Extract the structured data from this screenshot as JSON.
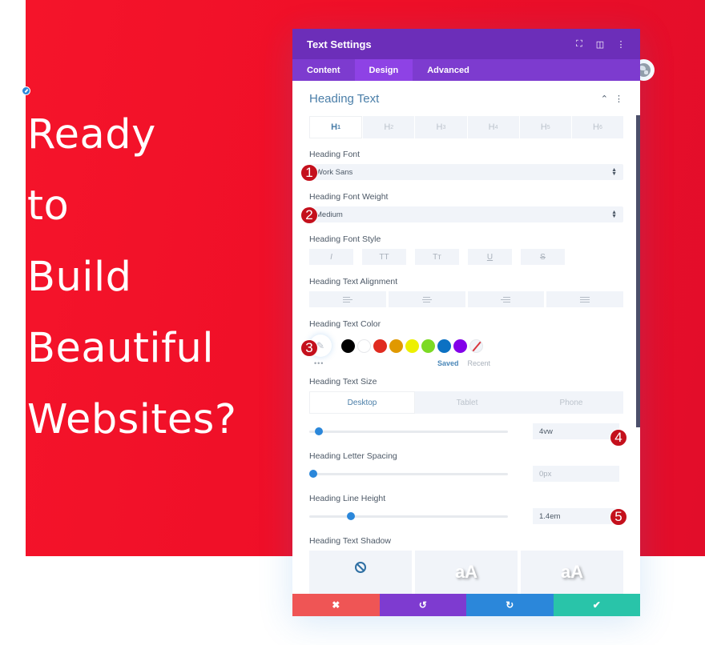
{
  "hero": {
    "heading_lines": [
      "Ready",
      "to",
      "Build",
      "Beautiful",
      "Websites?"
    ],
    "background_color": "#f0102a"
  },
  "modal": {
    "title": "Text Settings",
    "header_icons": [
      "expand-icon",
      "split-view-icon",
      "more-vertical-icon"
    ],
    "tabs": [
      {
        "label": "Content",
        "active": false
      },
      {
        "label": "Design",
        "active": true
      },
      {
        "label": "Advanced",
        "active": false
      }
    ],
    "section": {
      "title": "Heading Text",
      "heading_levels": [
        {
          "label": "H",
          "sub": "1",
          "active": true
        },
        {
          "label": "H",
          "sub": "2",
          "active": false
        },
        {
          "label": "H",
          "sub": "3",
          "active": false
        },
        {
          "label": "H",
          "sub": "4",
          "active": false
        },
        {
          "label": "H",
          "sub": "5",
          "active": false
        },
        {
          "label": "H",
          "sub": "6",
          "active": false
        }
      ],
      "font": {
        "label": "Heading Font",
        "value": "Work Sans",
        "badge": "1"
      },
      "font_weight": {
        "label": "Heading Font Weight",
        "value": "Medium",
        "badge": "2"
      },
      "font_style": {
        "label": "Heading Font Style",
        "options": [
          "I",
          "TT",
          "Tт",
          "U",
          "S"
        ]
      },
      "alignment": {
        "label": "Heading Text Alignment",
        "options": [
          "left",
          "center",
          "right",
          "justify"
        ]
      },
      "text_color": {
        "label": "Heading Text Color",
        "badge": "3",
        "swatches": [
          "#000000",
          "#ffffff",
          "#e02b20",
          "#e09900",
          "#edf000",
          "#7cda24",
          "#0c71c3",
          "#8300e9"
        ],
        "more": "•••",
        "saved_label": "Saved",
        "recent_label": "Recent"
      },
      "text_size": {
        "label": "Heading Text Size",
        "devices": [
          {
            "label": "Desktop",
            "active": true
          },
          {
            "label": "Tablet",
            "active": false
          },
          {
            "label": "Phone",
            "active": false
          }
        ],
        "value": "4vw",
        "slider_fraction": 0.05,
        "badge": "4"
      },
      "letter_spacing": {
        "label": "Heading Letter Spacing",
        "value": "0px",
        "slider_fraction": 0.02
      },
      "line_height": {
        "label": "Heading Line Height",
        "value": "1.4em",
        "slider_fraction": 0.21,
        "badge": "5"
      },
      "text_shadow": {
        "label": "Heading Text Shadow",
        "options": [
          "none",
          "aA",
          "aA"
        ]
      }
    },
    "footer": {
      "cancel": "✖",
      "undo": "↺",
      "redo": "↻",
      "save": "✔"
    }
  }
}
